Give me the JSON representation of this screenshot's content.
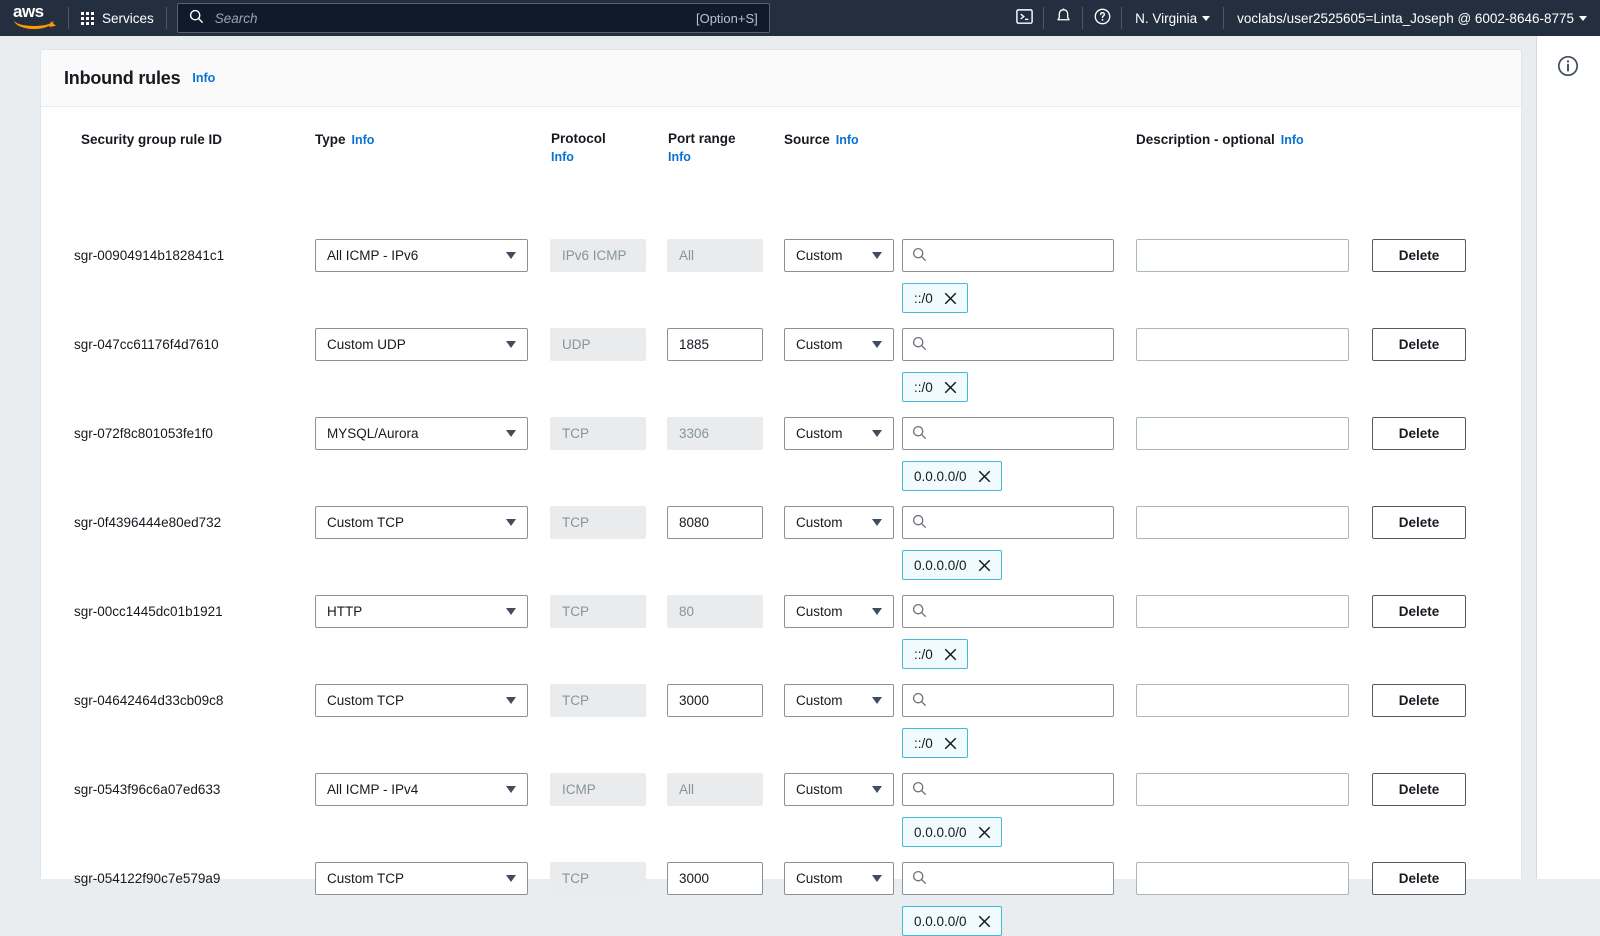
{
  "topnav": {
    "logo_alt": "aws",
    "services_label": "Services",
    "search": {
      "placeholder": "Search",
      "value": "",
      "shortcut": "[Option+S]"
    },
    "cloudshell_icon": "cloudshell-icon",
    "notifications_icon": "bell-icon",
    "help_icon": "question-circle-icon",
    "region_label": "N. Virginia",
    "account_label": "voclabs/user2525605=Linta_Joseph @ 6002-8646-8775"
  },
  "right_rail": {
    "info_icon": "info-circle-icon"
  },
  "panel": {
    "title": "Inbound rules",
    "info_label": "Info"
  },
  "columns": {
    "rule_id": "Security group rule ID",
    "type": "Type",
    "protocol": "Protocol",
    "port_range": "Port range",
    "source": "Source",
    "description": "Description - optional",
    "info_label": "Info"
  },
  "controls": {
    "delete_label": "Delete",
    "source_placeholder": "",
    "description_placeholder": "",
    "search_icon": "search-icon",
    "remove_chip_icon": "close-icon",
    "dropdown_icon": "chevron-down-icon"
  },
  "rows": [
    {
      "rule_id": "sgr-00904914b182841c1",
      "type": "All ICMP - IPv6",
      "protocol": "IPv6 ICMP",
      "protocol_disabled": true,
      "port_range": "All",
      "port_disabled": true,
      "source_type": "Custom",
      "source_value": "",
      "chip": "::/0",
      "description": ""
    },
    {
      "rule_id": "sgr-047cc61176f4d7610",
      "type": "Custom UDP",
      "protocol": "UDP",
      "protocol_disabled": true,
      "port_range": "1885",
      "port_disabled": false,
      "source_type": "Custom",
      "source_value": "",
      "chip": "::/0",
      "description": ""
    },
    {
      "rule_id": "sgr-072f8c801053fe1f0",
      "type": "MYSQL/Aurora",
      "protocol": "TCP",
      "protocol_disabled": true,
      "port_range": "3306",
      "port_disabled": true,
      "source_type": "Custom",
      "source_value": "",
      "chip": "0.0.0.0/0",
      "description": ""
    },
    {
      "rule_id": "sgr-0f4396444e80ed732",
      "type": "Custom TCP",
      "protocol": "TCP",
      "protocol_disabled": true,
      "port_range": "8080",
      "port_disabled": false,
      "source_type": "Custom",
      "source_value": "",
      "chip": "0.0.0.0/0",
      "description": ""
    },
    {
      "rule_id": "sgr-00cc1445dc01b1921",
      "type": "HTTP",
      "protocol": "TCP",
      "protocol_disabled": true,
      "port_range": "80",
      "port_disabled": true,
      "source_type": "Custom",
      "source_value": "",
      "chip": "::/0",
      "description": ""
    },
    {
      "rule_id": "sgr-04642464d33cb09c8",
      "type": "Custom TCP",
      "protocol": "TCP",
      "protocol_disabled": true,
      "port_range": "3000",
      "port_disabled": false,
      "source_type": "Custom",
      "source_value": "",
      "chip": "::/0",
      "description": ""
    },
    {
      "rule_id": "sgr-0543f96c6a07ed633",
      "type": "All ICMP - IPv4",
      "protocol": "ICMP",
      "protocol_disabled": true,
      "port_range": "All",
      "port_disabled": true,
      "source_type": "Custom",
      "source_value": "",
      "chip": "0.0.0.0/0",
      "description": ""
    },
    {
      "rule_id": "sgr-054122f90c7e579a9",
      "type": "Custom TCP",
      "protocol": "TCP",
      "protocol_disabled": true,
      "port_range": "3000",
      "port_disabled": false,
      "source_type": "Custom",
      "source_value": "",
      "chip": "0.0.0.0/0",
      "description": ""
    }
  ],
  "colors": {
    "nav_bg": "#232f3e",
    "link": "#0972d3",
    "chip_bg": "#f1faff",
    "chip_border": "#44b9d6",
    "accent_orange": "#ff9900"
  }
}
